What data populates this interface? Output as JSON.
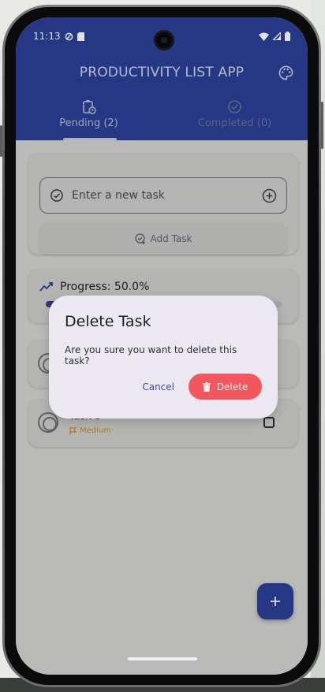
{
  "status_bar": {
    "time": "11:13"
  },
  "app": {
    "title": "PRODUCTIVITY LIST APP",
    "tabs": [
      {
        "label": "Pending (2)",
        "icon": "clipboard-clock-icon",
        "active": true
      },
      {
        "label": "Completed (0)",
        "icon": "check-circle-icon",
        "active": false
      }
    ]
  },
  "task_input": {
    "placeholder": "Enter a new task"
  },
  "add_task": {
    "label": "Add Task"
  },
  "progress": {
    "label": "Progress: 50.0%",
    "value": 0.5
  },
  "tasks": [
    {
      "title": "",
      "priority": ""
    },
    {
      "title": "Task 3",
      "priority": "Medium"
    }
  ],
  "dialog": {
    "title": "Delete Task",
    "message": "Are you sure you want to delete this task?",
    "cancel_label": "Cancel",
    "delete_label": "Delete"
  },
  "colors": {
    "primary": "#2b3f98",
    "danger": "#f2575e",
    "priority_medium": "#c98a2a"
  }
}
